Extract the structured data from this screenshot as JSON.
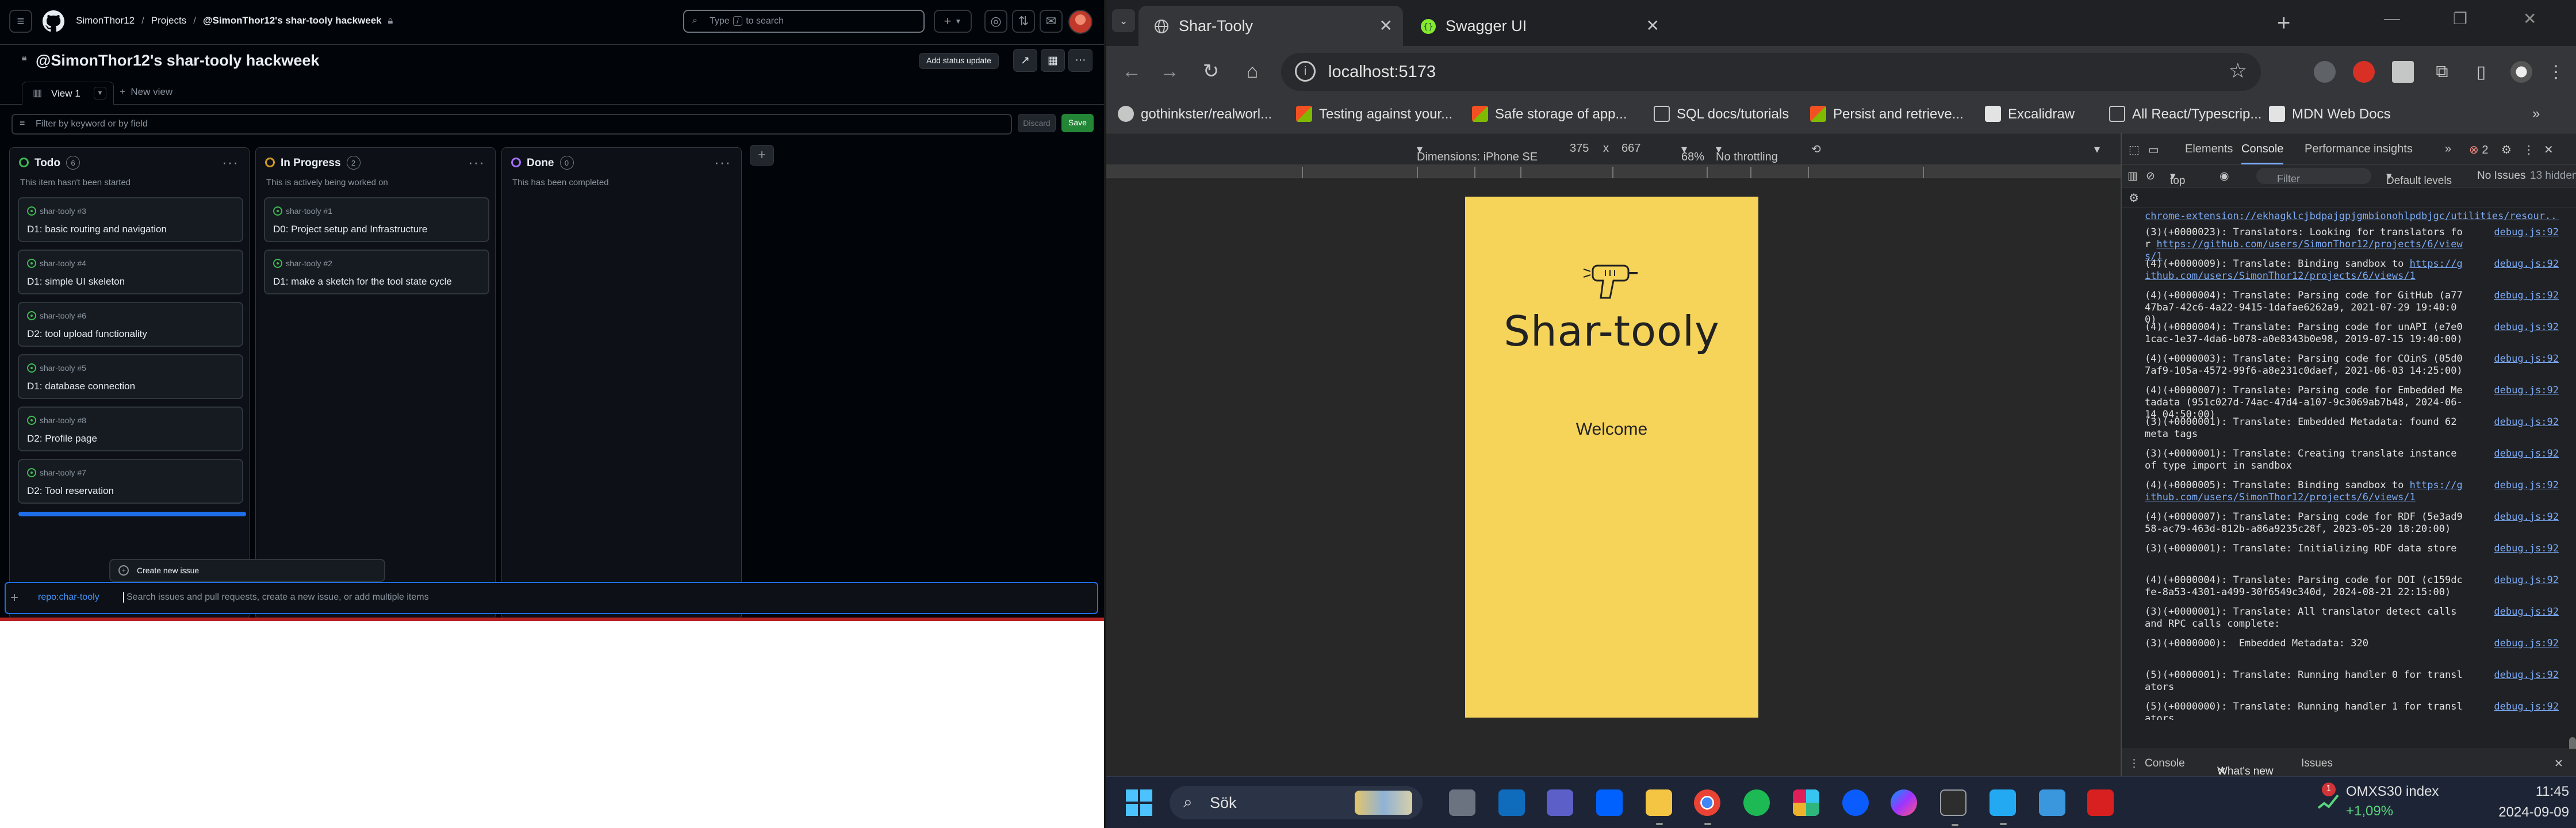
{
  "github": {
    "breadcrumb": [
      "SimonThor12",
      "Projects",
      "@SimonThor12's shar-tooly hackweek"
    ],
    "search": {
      "prefix": "Type",
      "key": "/",
      "suffix": "to search"
    },
    "project_title": "@SimonThor12's shar-tooly hackweek",
    "add_status_update": "Add status update",
    "view_tab": "View 1",
    "new_view": "New view",
    "filter_placeholder": "Filter by keyword or by field",
    "discard": "Discard",
    "save": "Save",
    "columns": [
      {
        "name": "Todo",
        "count": "6",
        "color": "#3fb950",
        "description": "This item hasn't been started",
        "cards": [
          {
            "repo": "shar-tooly #3",
            "title": "D1: basic routing and navigation"
          },
          {
            "repo": "shar-tooly #4",
            "title": "D1: simple UI skeleton"
          },
          {
            "repo": "shar-tooly #6",
            "title": "D2: tool upload functionality"
          },
          {
            "repo": "shar-tooly #5",
            "title": "D1: database connection"
          },
          {
            "repo": "shar-tooly #8",
            "title": "D2: Profile page"
          },
          {
            "repo": "shar-tooly #7",
            "title": "D2: Tool reservation"
          }
        ]
      },
      {
        "name": "In Progress",
        "count": "2",
        "color": "#d29922",
        "description": "This is actively being worked on",
        "cards": [
          {
            "repo": "shar-tooly #1",
            "title": "D0: Project setup and Infrastructure"
          },
          {
            "repo": "shar-tooly #2",
            "title": "D1: make a sketch for the tool state cycle"
          }
        ]
      },
      {
        "name": "Done",
        "count": "0",
        "color": "#a371f7",
        "description": "This has been completed",
        "cards": []
      }
    ],
    "create_new_issue": "Create new issue",
    "add_item_repo": "repo:char-tooly",
    "add_item_placeholder": "Search issues and pull requests, create a new issue, or add multiple items"
  },
  "chrome": {
    "tabs": [
      {
        "title": "Shar-Tooly",
        "active": true
      },
      {
        "title": "Swagger UI",
        "active": false
      }
    ],
    "url": "localhost:5173",
    "bookmarks": [
      "gothinkster/realworl...",
      "Testing against your...",
      "Safe storage of app...",
      "SQL docs/tutorials",
      "Persist and retrieve...",
      "Excalidraw",
      "All React/Typescrip...",
      "MDN Web Docs"
    ],
    "device_toolbar": {
      "dimensions_label": "Dimensions: iPhone SE",
      "width": "375",
      "times": "x",
      "height": "667",
      "zoom": "68%",
      "throttling": "No throttling"
    },
    "app": {
      "name": "Shar-tooly",
      "welcome": "Welcome"
    }
  },
  "devtools": {
    "tabs": [
      "Elements",
      "Console",
      "Performance insights"
    ],
    "active_tab": "Console",
    "error_count": "2",
    "context": "top",
    "filter_placeholder": "Filter",
    "levels": "Default levels",
    "issues": "No Issues",
    "hidden": "13 hidden",
    "top_url": "chrome-extension://ekhagklcjbdpajgpjgmbionohlpdbjgc/utilities/resour...",
    "logs": [
      {
        "text": "(3)(+0000023): Translators: Looking for translators for ",
        "link": "https://github.com/users/SimonThor12/projects/6/views/1",
        "src": "debug.js:92"
      },
      {
        "text": "(4)(+0000009): Translate: Binding sandbox to ",
        "link": "https://github.com/users/SimonThor12/projects/6/views/1",
        "src": "debug.js:92"
      },
      {
        "text": "(4)(+0000004): Translate: Parsing code for GitHub (a7747ba7-42c6-4a22-9415-1dafae6262a9, 2021-07-29 19:40:00)",
        "link": "",
        "src": "debug.js:92"
      },
      {
        "text": "(4)(+0000004): Translate: Parsing code for unAPI (e7e01cac-1e37-4da6-b078-a0e8343b0e98, 2019-07-15 19:40:00)",
        "link": "",
        "src": "debug.js:92"
      },
      {
        "text": "(4)(+0000003): Translate: Parsing code for COinS (05d07af9-105a-4572-99f6-a8e231c0daef, 2021-06-03 14:25:00)",
        "link": "",
        "src": "debug.js:92"
      },
      {
        "text": "(4)(+0000007): Translate: Parsing code for Embedded Metadata (951c027d-74ac-47d4-a107-9c3069ab7b48, 2024-06-14 04:50:00)",
        "link": "",
        "src": "debug.js:92"
      },
      {
        "text": "(3)(+0000001): Translate: Embedded Metadata: found 62 meta tags",
        "link": "",
        "src": "debug.js:92"
      },
      {
        "text": "(3)(+0000001): Translate: Creating translate instance of type import in sandbox",
        "link": "",
        "src": "debug.js:92"
      },
      {
        "text": "(4)(+0000005): Translate: Binding sandbox to ",
        "link": "https://github.com/users/SimonThor12/projects/6/views/1",
        "src": "debug.js:92"
      },
      {
        "text": "(4)(+0000007): Translate: Parsing code for RDF (5e3ad958-ac79-463d-812b-a86a9235c28f, 2023-05-20 18:20:00)",
        "link": "",
        "src": "debug.js:92"
      },
      {
        "text": "(3)(+0000001): Translate: Initializing RDF data store",
        "link": "",
        "src": "debug.js:92"
      },
      {
        "text": "(4)(+0000004): Translate: Parsing code for DOI (c159dcfe-8a53-4301-a499-30f6549c340d, 2024-08-21 22:15:00)",
        "link": "",
        "src": "debug.js:92"
      },
      {
        "text": "(3)(+0000001): Translate: All translator detect calls and RPC calls complete:",
        "link": "",
        "src": "debug.js:92"
      },
      {
        "text": "(3)(+0000000):  Embedded Metadata: 320",
        "link": "",
        "src": "debug.js:92"
      },
      {
        "text": "(5)(+0000001): Translate: Running handler 0 for translators",
        "link": "",
        "src": "debug.js:92"
      },
      {
        "text": "(5)(+0000000): Translate: Running handler 1 for translators",
        "link": "",
        "src": "debug.js:92"
      }
    ],
    "drawer_tabs": [
      "Console",
      "What's new",
      "Issues"
    ],
    "drawer_active": "What's new"
  },
  "taskbar": {
    "search": "Sök",
    "stock_name": "OMXS30 index",
    "stock_change": "+1,09%",
    "stock_badge": "1",
    "time": "11:45",
    "date": "2024-09-09"
  }
}
